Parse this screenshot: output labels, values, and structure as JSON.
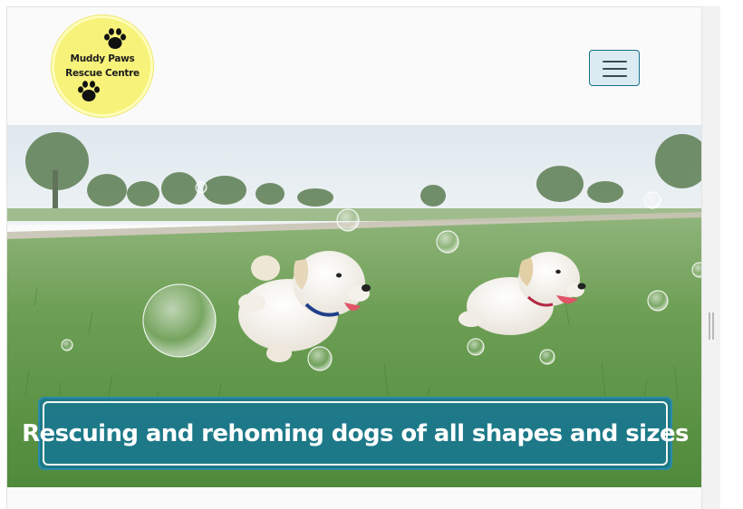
{
  "header": {
    "logo": {
      "line1": "Muddy Paws",
      "line2": "Rescue Centre",
      "icon": "paw-print-icon",
      "color": "#f7f27a"
    },
    "menu_toggle": {
      "icon": "hamburger-menu-icon"
    }
  },
  "hero": {
    "banner_text": "Rescuing and rehoming dogs of all shapes and sizes",
    "banner_color": "#1b7a99"
  }
}
